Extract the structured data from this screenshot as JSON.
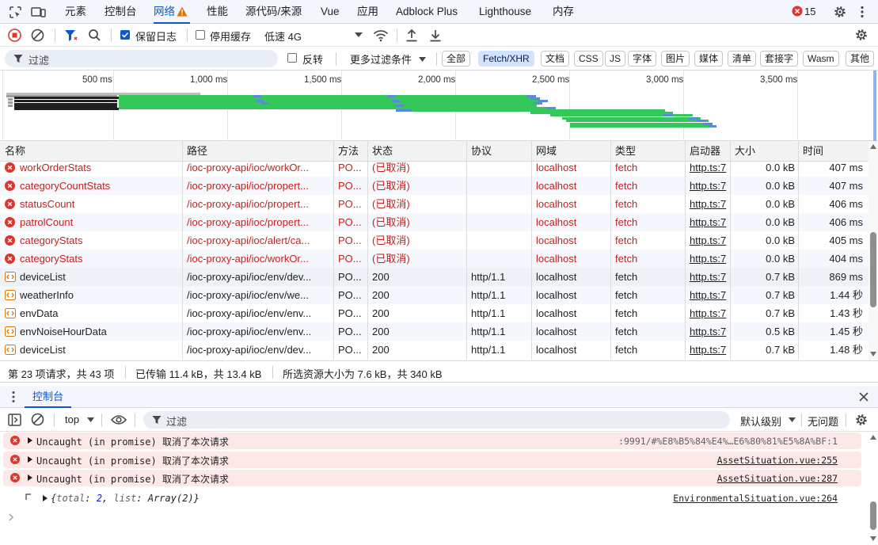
{
  "tabs": [
    "元素",
    "控制台",
    "网络",
    "性能",
    "源代码/来源",
    "Vue",
    "应用",
    "Adblock Plus",
    "Lighthouse",
    "内存"
  ],
  "error_count": "15",
  "toolbar": {
    "preserve_log": "保留日志",
    "disable_cache": "停用缓存",
    "throttle": "低速 4G"
  },
  "filter": {
    "placeholder": "过滤",
    "invert": "反转",
    "more_filters": "更多过滤条件",
    "chips": [
      "全部",
      "Fetch/XHR",
      "文档",
      "CSS",
      "JS",
      "字体",
      "图片",
      "媒体",
      "清单",
      "套接字",
      "Wasm",
      "其他"
    ],
    "selected": "Fetch/XHR"
  },
  "overview": {
    "ticks": [
      "500 ms",
      "1,000 ms",
      "1,500 ms",
      "2,000 ms",
      "2,500 ms",
      "3,000 ms",
      "3,500 ms"
    ]
  },
  "columns": [
    "名称",
    "路径",
    "方法",
    "状态",
    "协议",
    "网域",
    "类型",
    "启动器",
    "大小",
    "时间"
  ],
  "rows": [
    {
      "name": "workOrderStats",
      "path": "/ioc-proxy-api/ioc/workOr...",
      "method": "PO...",
      "status": "(已取消)",
      "protocol": "",
      "domain": "localhost",
      "type": "fetch",
      "initiator": "http.ts:7",
      "size": "0.0 kB",
      "time": "407 ms",
      "error": true
    },
    {
      "name": "categoryCountStats",
      "path": "/ioc-proxy-api/ioc/propert...",
      "method": "PO...",
      "status": "(已取消)",
      "protocol": "",
      "domain": "localhost",
      "type": "fetch",
      "initiator": "http.ts:7",
      "size": "0.0 kB",
      "time": "407 ms",
      "error": true
    },
    {
      "name": "statusCount",
      "path": "/ioc-proxy-api/ioc/propert...",
      "method": "PO...",
      "status": "(已取消)",
      "protocol": "",
      "domain": "localhost",
      "type": "fetch",
      "initiator": "http.ts:7",
      "size": "0.0 kB",
      "time": "406 ms",
      "error": true
    },
    {
      "name": "patrolCount",
      "path": "/ioc-proxy-api/ioc/propert...",
      "method": "PO...",
      "status": "(已取消)",
      "protocol": "",
      "domain": "localhost",
      "type": "fetch",
      "initiator": "http.ts:7",
      "size": "0.0 kB",
      "time": "406 ms",
      "error": true
    },
    {
      "name": "categoryStats",
      "path": "/ioc-proxy-api/ioc/alert/ca...",
      "method": "PO...",
      "status": "(已取消)",
      "protocol": "",
      "domain": "localhost",
      "type": "fetch",
      "initiator": "http.ts:7",
      "size": "0.0 kB",
      "time": "405 ms",
      "error": true
    },
    {
      "name": "categoryStats",
      "path": "/ioc-proxy-api/ioc/workOr...",
      "method": "PO...",
      "status": "(已取消)",
      "protocol": "",
      "domain": "localhost",
      "type": "fetch",
      "initiator": "http.ts:7",
      "size": "0.0 kB",
      "time": "404 ms",
      "error": true
    },
    {
      "name": "deviceList",
      "path": "/ioc-proxy-api/ioc/env/dev...",
      "method": "PO...",
      "status": "200",
      "protocol": "http/1.1",
      "domain": "localhost",
      "type": "fetch",
      "initiator": "http.ts:7",
      "size": "0.7 kB",
      "time": "869 ms",
      "error": false
    },
    {
      "name": "weatherInfo",
      "path": "/ioc-proxy-api/ioc/env/we...",
      "method": "PO...",
      "status": "200",
      "protocol": "http/1.1",
      "domain": "localhost",
      "type": "fetch",
      "initiator": "http.ts:7",
      "size": "0.7 kB",
      "time": "1.44 秒",
      "error": false
    },
    {
      "name": "envData",
      "path": "/ioc-proxy-api/ioc/env/env...",
      "method": "PO...",
      "status": "200",
      "protocol": "http/1.1",
      "domain": "localhost",
      "type": "fetch",
      "initiator": "http.ts:7",
      "size": "0.7 kB",
      "time": "1.43 秒",
      "error": false
    },
    {
      "name": "envNoiseHourData",
      "path": "/ioc-proxy-api/ioc/env/env...",
      "method": "PO...",
      "status": "200",
      "protocol": "http/1.1",
      "domain": "localhost",
      "type": "fetch",
      "initiator": "http.ts:7",
      "size": "0.5 kB",
      "time": "1.45 秒",
      "error": false
    },
    {
      "name": "deviceList",
      "path": "/ioc-proxy-api/ioc/env/dev...",
      "method": "PO...",
      "status": "200",
      "protocol": "http/1.1",
      "domain": "localhost",
      "type": "fetch",
      "initiator": "http.ts:7",
      "size": "0.7 kB",
      "time": "1.48 秒",
      "error": false
    }
  ],
  "statusbar": {
    "requests": "第 23 项请求，共 43 项",
    "transferred": "已传输 11.4 kB，共 13.4 kB",
    "resources": "所选资源大小为 7.6 kB，共 340 kB"
  },
  "drawer": {
    "tab": "控制台",
    "context": "top",
    "filter_placeholder": "过滤",
    "levels": "默认级别",
    "issues": "无问题"
  },
  "console": {
    "messages": [
      {
        "text": "Uncaught (in promise) 取消了本次请求",
        "source": ":9991/#%E8%B5%84%E4%…E6%80%81%E5%8A%BF:1"
      },
      {
        "text": "Uncaught (in promise) 取消了本次请求",
        "source": "AssetSituation.vue:255"
      },
      {
        "text": "Uncaught (in promise) 取消了本次请求",
        "source": "AssetSituation.vue:287"
      }
    ],
    "object_log": {
      "prefix": "{",
      "key1": "total",
      "val1": "2",
      "key2": "list",
      "val2": "Array(2)",
      "suffix": "}",
      "source": "EnvironmentalSituation.vue:264"
    }
  },
  "colors": {
    "accent": "#0b57d0",
    "error": "#c5221f",
    "green": "#34c759",
    "error_bg": "#fce8e6"
  }
}
